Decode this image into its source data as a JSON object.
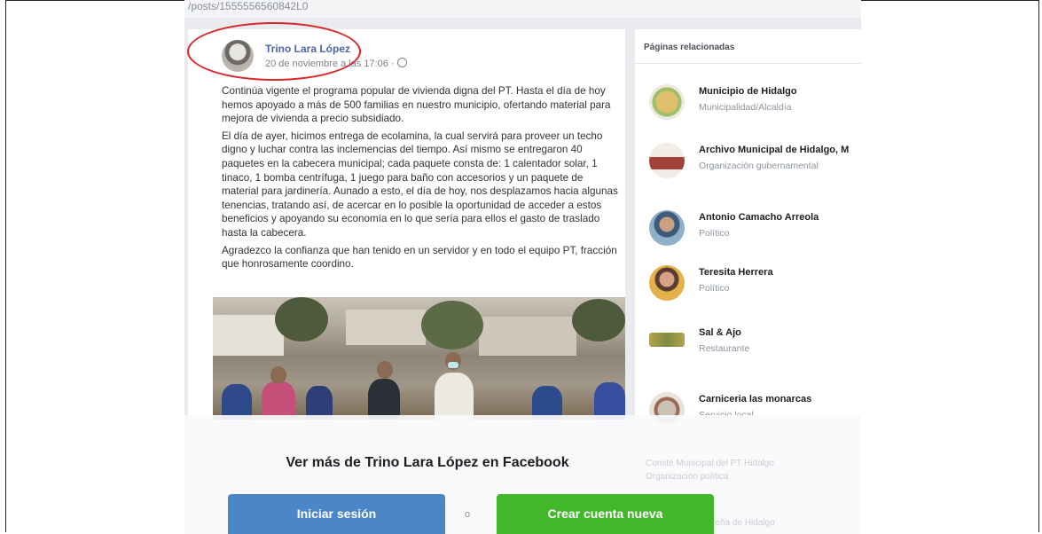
{
  "browser": {
    "url_fragment": "/posts/1555556560842L0"
  },
  "post": {
    "author": "Trino Lara López",
    "date": "20 de noviembre a las 17:06 ·",
    "paragraphs": [
      "Continúa vigente el programa popular de vivienda digna del PT. Hasta el día de hoy hemos apoyado a más de 500 familias en nuestro municipio, ofertando material para mejora de vivienda a precio subsidiado.",
      "El día de ayer, hicimos entrega de ecolamina, la cual servirá para proveer un techo digno y luchar contra las inclemencias del tiempo. Así mismo se entregaron 40 paquetes en la cabecera municipal; cada paquete consta de: 1 calentador solar, 1 tinaco, 1 bomba centrífuga, 1 juego para baño con accesorios y un paquete de material para jardinería. Aunado a esto, el día de hoy, nos desplazamos hacia algunas tenencias, tratando así, de acercar en lo posible la oportunidad de acceder a estos beneficios y apoyando su economía en lo que sería para ellos el gasto de traslado hasta la cabecera.",
      "Agradezco la confianza que han tenido en un servidor y en todo el equipo PT, fracción que honrosamente coordino."
    ]
  },
  "related": {
    "title": "Páginas relacionadas",
    "pages": [
      {
        "name": "Municipio de Hidalgo",
        "category": "Municipalidad/Alcaldía",
        "icon": "municipio-logo-icon",
        "color": "#c9a95a"
      },
      {
        "name": "Archivo Municipal de Hidalgo, M",
        "category": "Organización gubernamental",
        "icon": "archivo-logo-icon",
        "color": "#a3413b"
      },
      {
        "name": "Antonio Camacho Arreola",
        "category": "Político",
        "icon": "profile-photo-icon",
        "color": "#4f7fa6"
      },
      {
        "name": "Teresita Herrera",
        "category": "Político",
        "icon": "profile-photo-icon",
        "color": "#c88a6a"
      },
      {
        "name": "Sal & Ajo",
        "category": "Restaurante",
        "icon": "sal-ajo-logo-icon",
        "color": "#b5a24d"
      },
      {
        "name": "Carniceria las monarcas",
        "category": "Servicio local",
        "icon": "carniceria-logo-icon",
        "color": "#9a6a55"
      }
    ],
    "faded": [
      "Comité Municipal del PT Hidalgo",
      "Organización política",
      "Carnicería la Norteña de Hidalgo"
    ]
  },
  "cta": {
    "see_more": "Ver más de Trino Lara López en Facebook",
    "login": "Iniciar sesión",
    "or": "o",
    "create": "Crear cuenta nueva"
  },
  "colors": {
    "link_blue": "#4a66a8",
    "login_blue": "#4a86c8",
    "create_green": "#42b72a",
    "annotation_red": "#d9272a"
  }
}
